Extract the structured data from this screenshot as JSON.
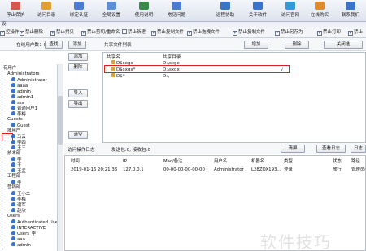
{
  "toolbar": {
    "buttons": [
      {
        "label": "停止保护",
        "icon": "shield-stop-icon",
        "color": "#d9534f"
      },
      {
        "label": "访问目录",
        "icon": "folder-icon",
        "color": "#e0a030"
      },
      {
        "label": "绑定认证",
        "icon": "link-icon",
        "color": "#4a7bd0"
      },
      {
        "label": "全局设置",
        "icon": "gear-icon",
        "color": "#5c8fd6"
      },
      {
        "label": "使用说明",
        "icon": "book-icon",
        "color": "#3b8a4a"
      },
      {
        "label": "常见问题",
        "icon": "question-icon",
        "color": "#4a7bd0"
      },
      {
        "label": "远程协助",
        "icon": "remote-icon",
        "color": "#3a73c8"
      },
      {
        "label": "关于软件",
        "icon": "info-icon",
        "color": "#3a73c8"
      },
      {
        "label": "访问官网",
        "icon": "globe-icon",
        "color": "#2f9bd8"
      },
      {
        "label": "在线购买",
        "icon": "cart-icon",
        "color": "#e08a2a"
      },
      {
        "label": "联系我们",
        "icon": "contact-icon",
        "color": "#3a73c8"
      }
    ]
  },
  "section_title": "设",
  "options": [
    {
      "label": "控操作",
      "checked": true
    },
    {
      "label": "禁止删除",
      "checked": true
    },
    {
      "label": "禁止拷贝",
      "checked": true
    },
    {
      "label": "禁止剪切/重命名",
      "checked": true
    },
    {
      "label": "禁止新建",
      "checked": false
    },
    {
      "label": "禁止复制文件",
      "checked": true
    },
    {
      "label": "禁止拖拽文件",
      "checked": true
    },
    {
      "label": "禁止复制文件",
      "checked": true
    },
    {
      "label": "禁止另存为",
      "checked": true
    },
    {
      "label": "禁止打印",
      "checked": true
    },
    {
      "label": "禁止",
      "checked": true
    }
  ],
  "bar2": {
    "online_users": "在线用户数：0",
    "search": "查找",
    "add": "添加",
    "share_list": "共享文件列表",
    "add_share": "增加",
    "delete_share": "删除",
    "close_share": "关闭选"
  },
  "mid_buttons": {
    "add": "添加",
    "delete": "删除",
    "import": "导入",
    "export": "导出",
    "clear": "清空"
  },
  "tree": {
    "items": [
      {
        "label": "有用户",
        "level": 0,
        "icon": false
      },
      {
        "label": "Administrators",
        "level": 1,
        "icon": false
      },
      {
        "label": "Administrator",
        "level": 2,
        "icon": true
      },
      {
        "label": "aaaa",
        "level": 2,
        "icon": true
      },
      {
        "label": "admin",
        "level": 2,
        "icon": true
      },
      {
        "label": "admin1",
        "level": 2,
        "icon": true
      },
      {
        "label": "sss",
        "level": 2,
        "icon": true
      },
      {
        "label": "普通用户1",
        "level": 2,
        "icon": true
      },
      {
        "label": "李梅",
        "level": 2,
        "icon": true
      },
      {
        "label": "Guests",
        "level": 1,
        "icon": false
      },
      {
        "label": "Guest",
        "level": 2,
        "icon": true
      },
      {
        "label": "域用户",
        "level": 1,
        "icon": false
      },
      {
        "label": "马云",
        "level": 2,
        "icon": true
      },
      {
        "label": "李四",
        "level": 2,
        "icon": true
      },
      {
        "label": "王三",
        "level": 2,
        "icon": true
      },
      {
        "label": "技术部",
        "level": 1,
        "icon": false
      },
      {
        "label": "李",
        "level": 2,
        "icon": true
      },
      {
        "label": "王",
        "level": 2,
        "icon": true
      },
      {
        "label": "王孟",
        "level": 2,
        "icon": true
      },
      {
        "label": "工程部",
        "level": 1,
        "icon": false
      },
      {
        "label": "李",
        "level": 2,
        "icon": true
      },
      {
        "label": "营销部",
        "level": 1,
        "icon": false
      },
      {
        "label": "王小二",
        "level": 2,
        "icon": true
      },
      {
        "label": "李梅",
        "level": 2,
        "icon": true
      },
      {
        "label": "谢军",
        "level": 2,
        "icon": true
      },
      {
        "label": "赵欣",
        "level": 2,
        "icon": true
      },
      {
        "label": "Users",
        "level": 1,
        "icon": false
      },
      {
        "label": "Authenticated Users",
        "level": 2,
        "icon": true
      },
      {
        "label": "INTERACTIVE",
        "level": 2,
        "icon": true
      },
      {
        "label": "Users_李",
        "level": 2,
        "icon": true
      },
      {
        "label": "aaa",
        "level": 2,
        "icon": true
      },
      {
        "label": "admin",
        "level": 2,
        "icon": true
      }
    ]
  },
  "share_list": {
    "headers": {
      "name": "共享名",
      "path": "共享目录"
    },
    "rows": [
      {
        "name": "D$sxgx",
        "path": "D:\\sxgx",
        "flag": ""
      },
      {
        "name": "D$sxgx*",
        "path": "D:\\sxgx",
        "flag": "√"
      },
      {
        "name": "D$*",
        "path": "D:\\",
        "flag": ""
      }
    ]
  },
  "log": {
    "title": "访问操作日志",
    "stats": "发送包:0, 接收包:0",
    "clear": "清屏",
    "save": "查看日志",
    "log": "日志",
    "headers": {
      "time": "时间",
      "ip": "IP",
      "mac": "Mac/备注",
      "user": "用户名",
      "host": "机器名",
      "type": "类型",
      "state": "状态",
      "path": "路径"
    },
    "rows": [
      {
        "time": "2019-01-16 20:21:36",
        "ip": "127.0.0.1",
        "mac": "00-00-00-00-00-00",
        "user": "Administrator",
        "host": "L28ZOX193...",
        "type": "登录",
        "state": "放行",
        "path": "管理员(共"
      }
    ]
  },
  "watermark": "软件技巧"
}
